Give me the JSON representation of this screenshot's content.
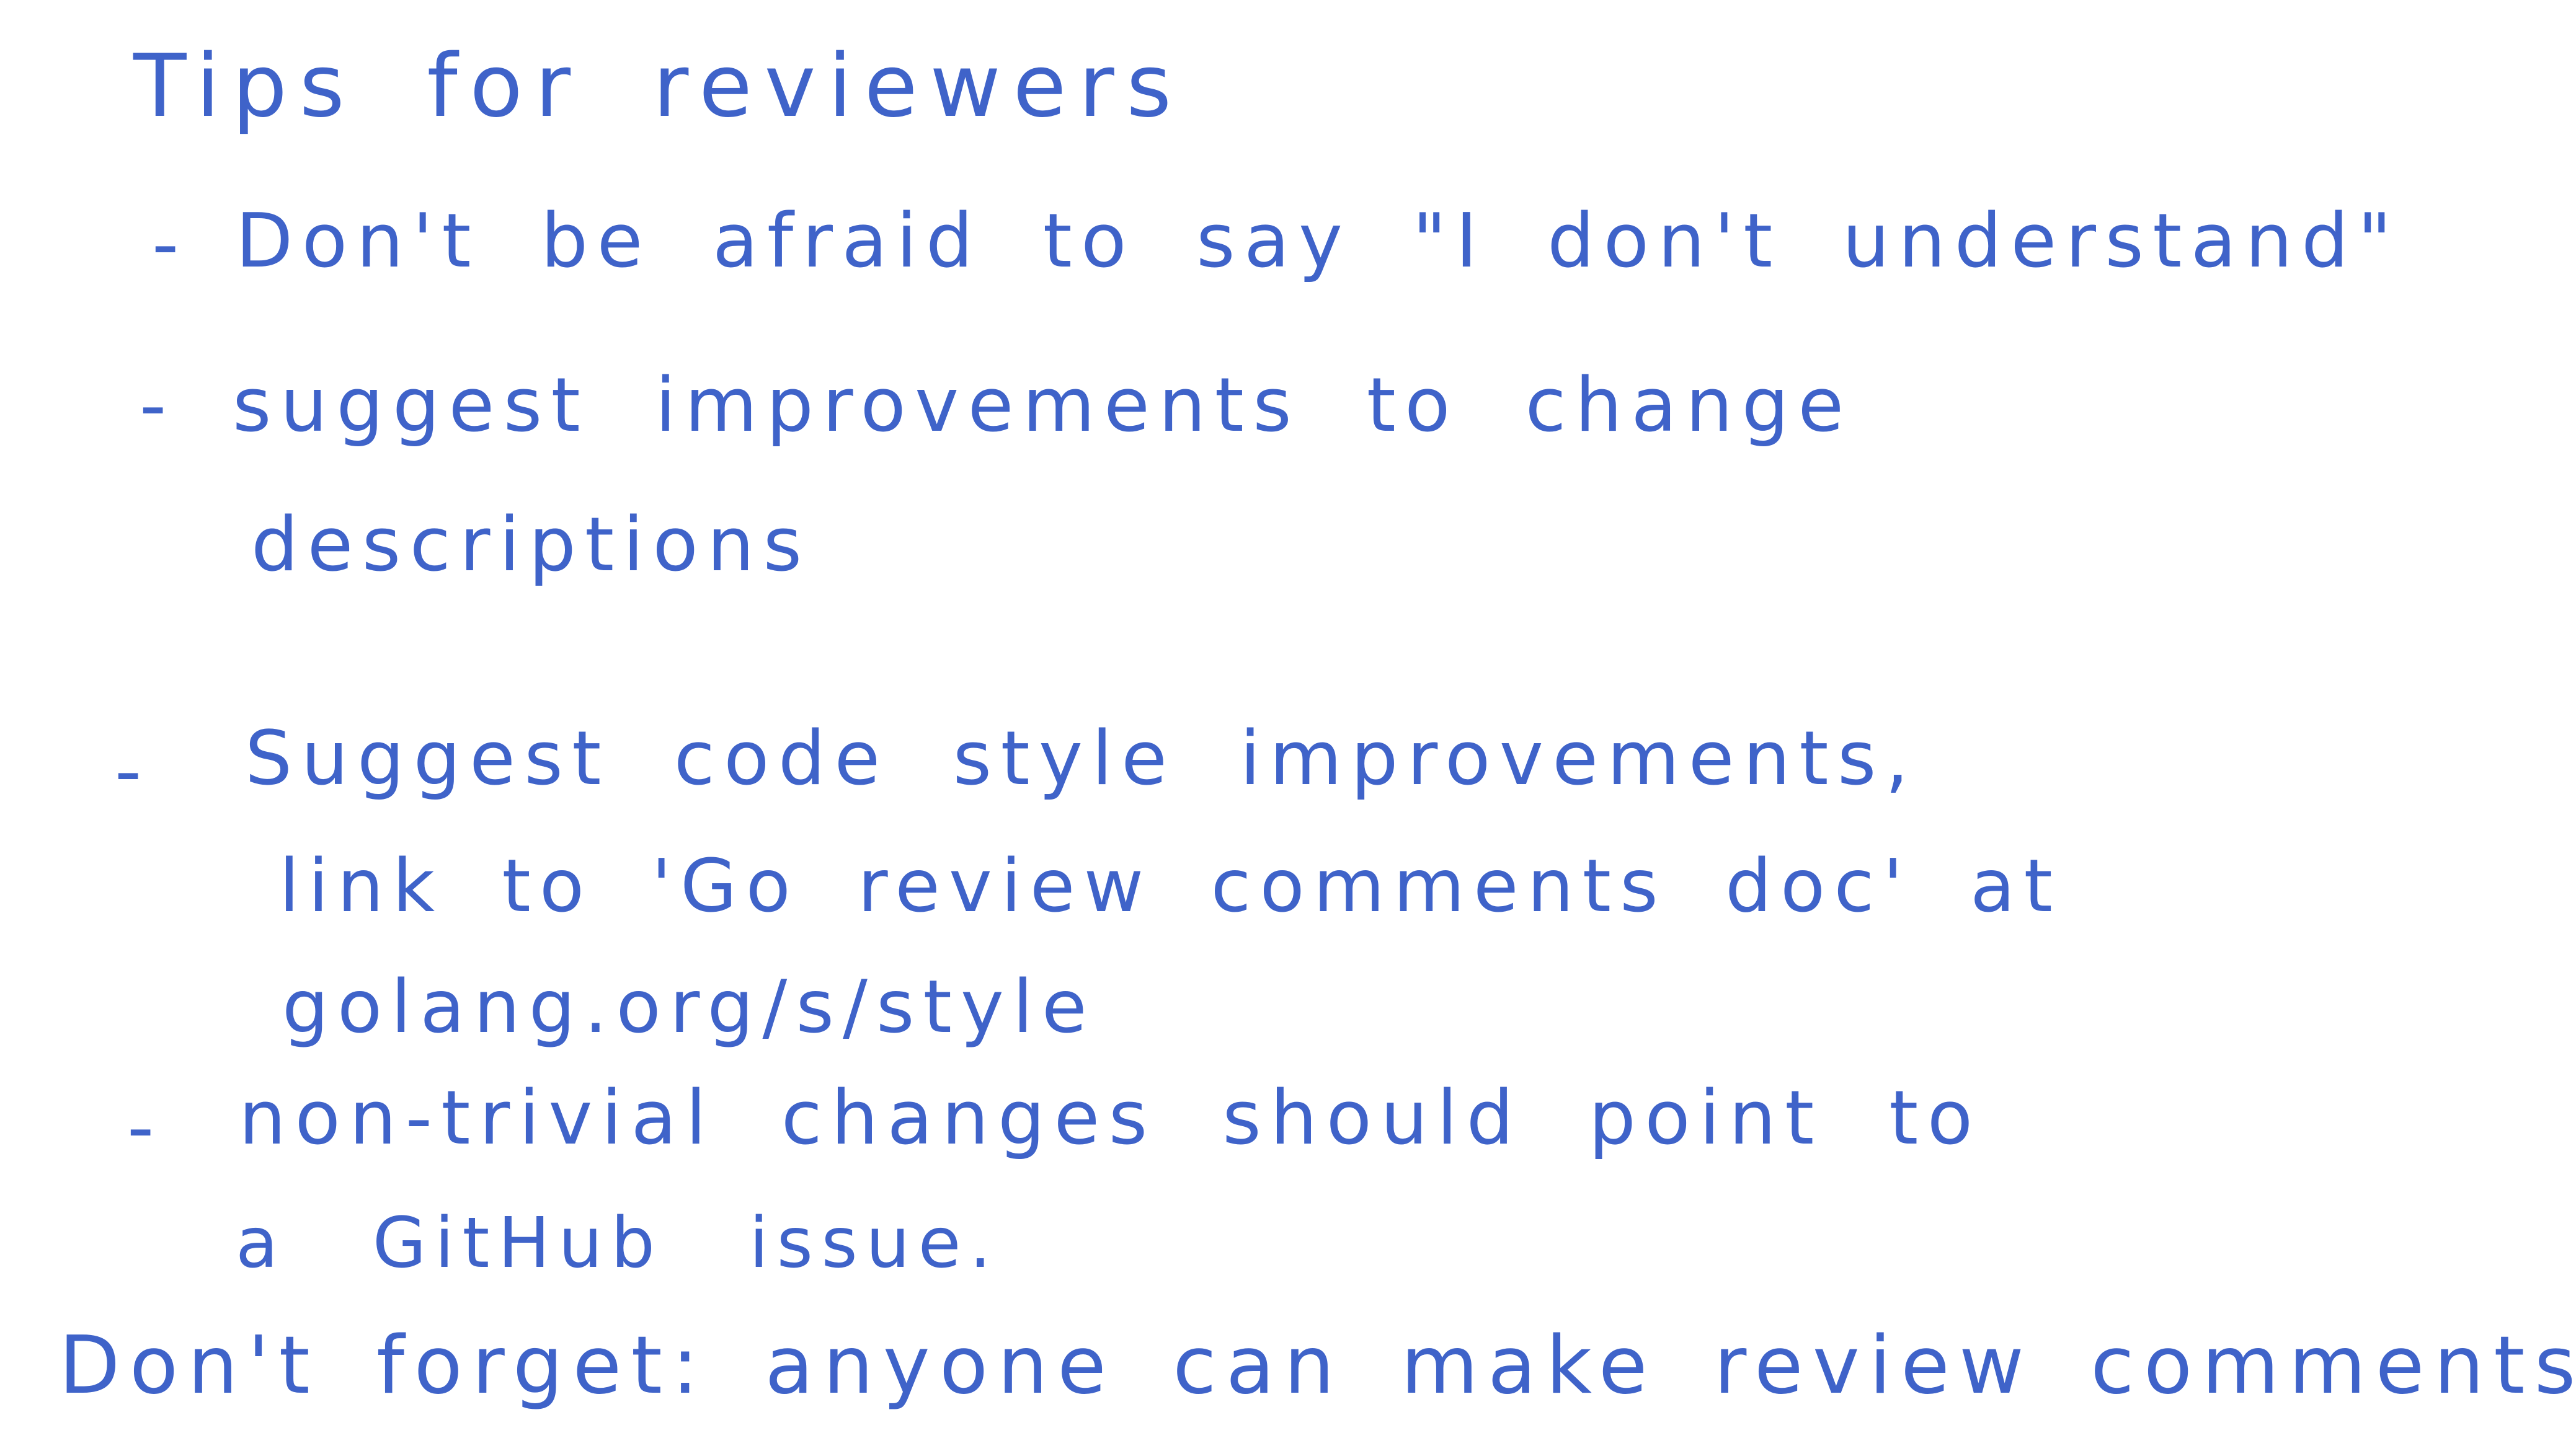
{
  "note": {
    "title": "Tips for reviewers",
    "bullet_marker": "-",
    "bullets": [
      {
        "lines": [
          "Don't be afraid to say \"I don't understand\""
        ]
      },
      {
        "lines": [
          "suggest improvements to change",
          "descriptions"
        ]
      },
      {
        "lines": [
          "Suggest code style improvements,",
          "link to 'Go review comments doc' at",
          "golang.org/s/style"
        ]
      },
      {
        "lines": [
          "non-trivial changes should point to",
          "a GitHub issue."
        ]
      }
    ],
    "footer": "Don't forget: anyone can make review comments!"
  },
  "colors": {
    "ink": "#3f63c9",
    "paper": "#ffffff"
  }
}
